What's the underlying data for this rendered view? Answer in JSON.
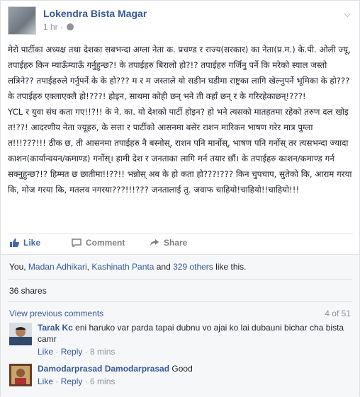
{
  "post": {
    "author": "Lokendra Bista Magar",
    "time": "1 hr",
    "menu_icon": "chevron-down-icon",
    "paragraphs": [
      "मेरो पार्टीका अध्यक्ष तथा देशका सबभन्दा अग्ला नेता क. प्रचण्ड र राज्य(सरकार) का नेता(प्र.म.) के.पी. ओली ज्यू, तपाईहरु किन म्याऊँम्याऊँ गर्नुहुन्छ?! के तपाईहरु बिरालो हो?!? तपाईहरु गर्जिनु पर्ने कि मरेको स्याल जस्तो लत्रिने?? तपाईहरुले गर्नुपर्ने के के हो??? म र म जस्ताले यो सङीन घडीमा राष्ट्रका लागि खेल्नुपर्ने भूमिका के हो??? के तपाईहरु एक्लाएक्लै हो!???! होइन, साथमा कोही छन् भने ती क्हाँ छन् र के गरिरहेकाछन्!???!",
      "YCL र युवा संघ कता गए!!?!! के ने. का. यो देशको पार्टी होइन? हो भने त्यसको मातहतमा रहेको तरुण दल खोइ त!??! आदरणीय नेता ज्यूहरु, के सत्ता र पार्टीको आसनमा बसेर राशन मारिकन भाषण गरेर मात्र पुग्ला त!!!???!!! ठीक छ, ती आसनमा तपाईहरु नै बस्नोस्, राशन पनि मार्नोस्, भाषण पनि गर्नोस् तर त्यसभन्दा ज्यादा काशन(कार्यान्वयन/कमाण्ड) गर्नोस्। हामी देश र जनताका लागि मर्न तयार छौं। के तपाईहरु काशन/कमाण्ड गर्न सक्नुहुन्छ?!? हिम्मत छ छातीमा!!??!! भन्नोस् अब के हो कता हो???!??? किन चुपचाप, सुतेको कि, आराम गरया कि, मोज गरया कि, मतलव नगरया???!!!??? जनतालाई तु. जवाफ चाहियो!चाहियो!!चाहियो!!!"
    ]
  },
  "actions": {
    "like": "Like",
    "comment": "Comment",
    "share": "Share"
  },
  "likes": {
    "prefix": "You, ",
    "names": [
      "Madan Adhikari",
      "Kashinath Panta"
    ],
    "and": " and ",
    "others": "329 others",
    "suffix": " like this."
  },
  "shares": "36 shares",
  "comments_nav": {
    "view_previous": "View previous comments",
    "count": "4 of 51"
  },
  "comments": [
    {
      "name": "Tarak Kc",
      "text": "eni haruko var parda tapai dubnu vo ajai ko lai dubauni bichar cha bista camr",
      "like": "Like",
      "reply": "Reply",
      "sep": " · ",
      "time": "8 mins"
    },
    {
      "name": "Damodarprasad Damodarprasad",
      "text": "Good",
      "like": "Like",
      "reply": "Reply",
      "sep": " · ",
      "time": "6 mins"
    }
  ]
}
